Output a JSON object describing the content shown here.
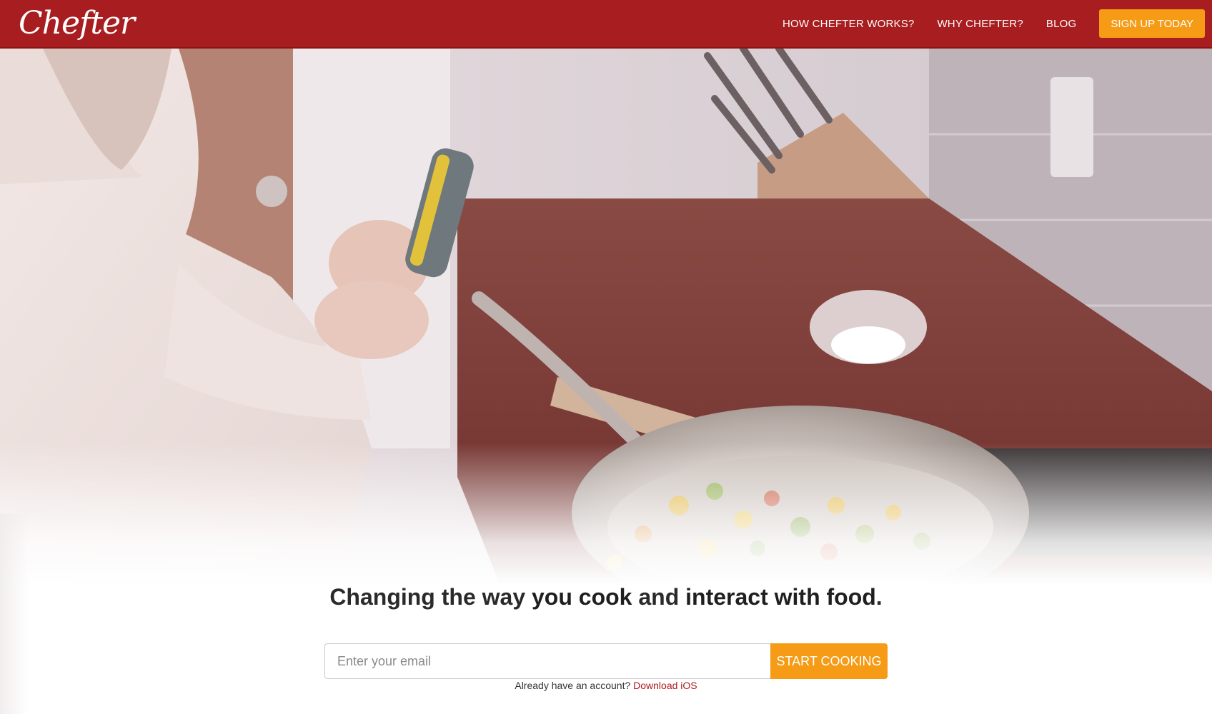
{
  "brand": {
    "logo_text": "Chefter"
  },
  "nav": {
    "links": [
      "HOW CHEFTER WORKS?",
      "WHY CHEFTER?",
      "BLOG"
    ],
    "cta": "SIGN UP TODAY"
  },
  "hero": {
    "image_alt": "Person cooking vegetables in a pan while using a phone in a kitchen"
  },
  "tagline": {
    "part1": "Changing the way ",
    "bold1": "you cook",
    "part2": " and ",
    "bold2": "interact with food",
    "part3": "."
  },
  "signup": {
    "email_placeholder": "Enter your email",
    "button_label": "START COOKING"
  },
  "account": {
    "prompt": "Already have an account? ",
    "link_text": "Download iOS"
  },
  "colors": {
    "navbar": "#a81d1f",
    "accent": "#f59b16",
    "link": "#b0191d"
  }
}
